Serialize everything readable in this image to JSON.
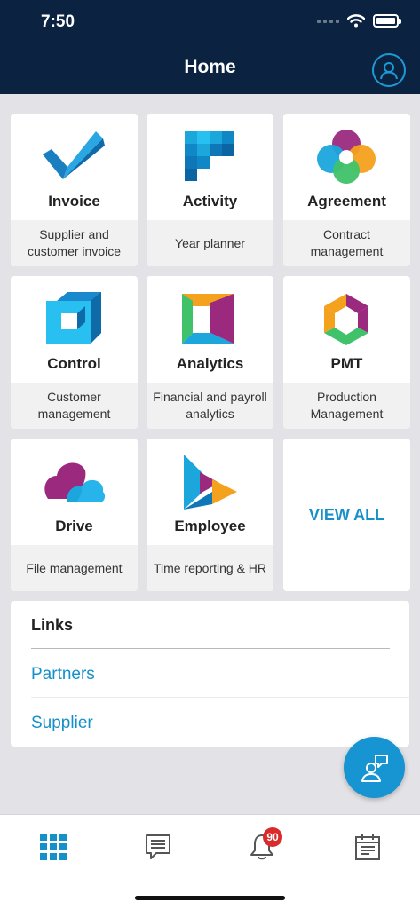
{
  "status_bar": {
    "time": "7:50"
  },
  "header": {
    "title": "Home"
  },
  "apps": [
    {
      "name": "Invoice",
      "description": "Supplier and customer invoice",
      "icon": "invoice-checkmark-icon"
    },
    {
      "name": "Activity",
      "description": "Year planner",
      "icon": "activity-grid-icon"
    },
    {
      "name": "Agreement",
      "description": "Contract management",
      "icon": "agreement-circles-icon"
    },
    {
      "name": "Control",
      "description": "Customer management",
      "icon": "control-cube-icon"
    },
    {
      "name": "Analytics",
      "description": "Financial and payroll analytics",
      "icon": "analytics-panels-icon"
    },
    {
      "name": "PMT",
      "description": "Production Management",
      "icon": "pmt-hexagon-icon"
    },
    {
      "name": "Drive",
      "description": "File management",
      "icon": "drive-cloud-icon"
    },
    {
      "name": "Employee",
      "description": "Time reporting & HR",
      "icon": "employee-play-icon"
    }
  ],
  "view_all_label": "VIEW ALL",
  "links": {
    "title": "Links",
    "items": [
      "Partners",
      "Supplier"
    ]
  },
  "tabbar": {
    "notification_count": "90",
    "tabs": [
      "grid-icon",
      "chat-list-icon",
      "bell-icon",
      "calendar-icon"
    ]
  },
  "colors": {
    "header_bg": "#0b2340",
    "accent": "#1590c9",
    "fab_bg": "#1795d3",
    "badge_bg": "#d92b2b",
    "page_bg": "#e3e2e7"
  }
}
